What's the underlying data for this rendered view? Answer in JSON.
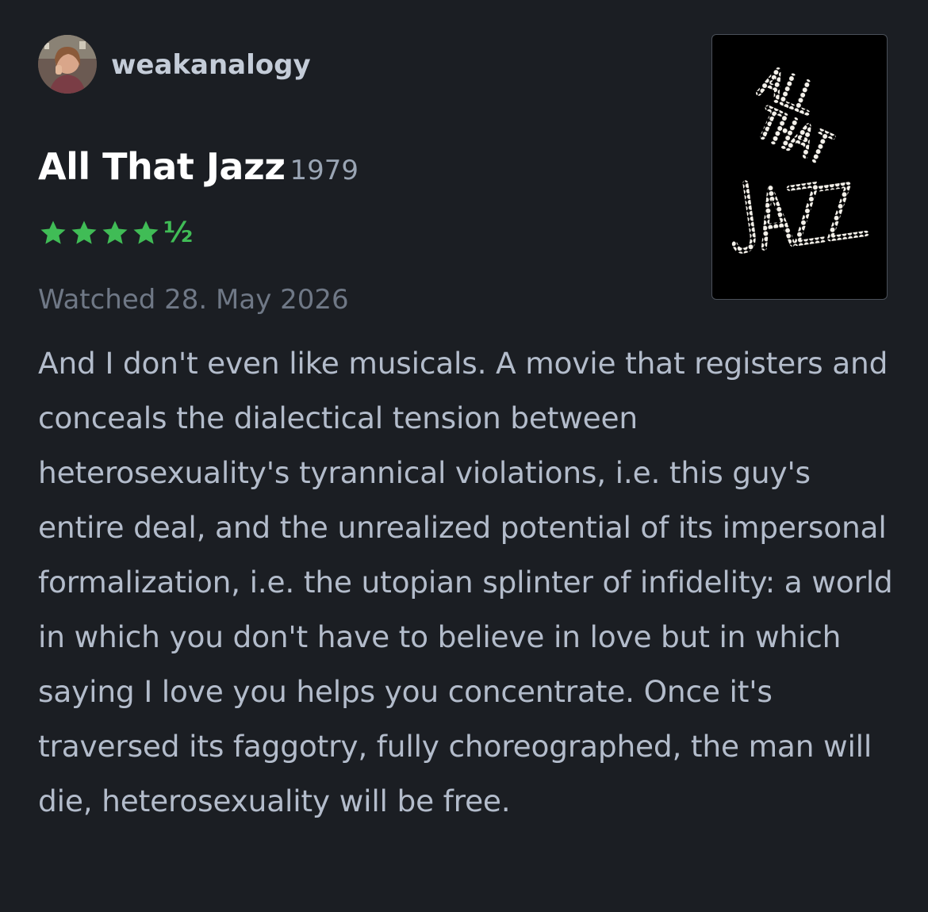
{
  "review": {
    "username": "weakanalogy",
    "film_title": "All That Jazz",
    "film_year": "1979",
    "rating": {
      "stars": 4.5,
      "half_symbol": "½",
      "color": "#40bc56"
    },
    "watched_label": "Watched 28. May 2026",
    "body": "And I don't even like musicals. A movie that registers and conceals the dialectical tension between heterosexuality's tyrannical violations, i.e. this guy's entire deal, and the unrealized potential of its impersonal formalization, i.e. the utopian splinter of infidelity: a world in which you don't have to believe in love but in which saying I love you helps you concentrate. Once it's traversed its faggotry, fully choreographed, the man will die, heterosexuality will be free.",
    "poster": {
      "logo_text": "ALL THAT JAZZ"
    }
  },
  "colors": {
    "background": "#1b1e23",
    "title": "#ffffff",
    "body_text": "#b3bccb",
    "muted": "#6f7886",
    "accent_green": "#40bc56"
  }
}
